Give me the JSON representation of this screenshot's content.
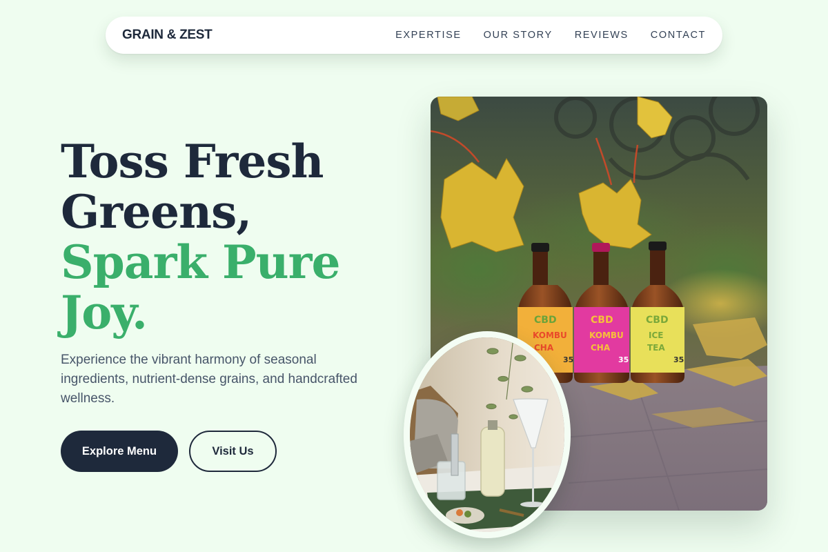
{
  "brand": {
    "name": "GRAIN & ZEST"
  },
  "nav": {
    "items": [
      {
        "label": "EXPERTISE"
      },
      {
        "label": "OUR STORY"
      },
      {
        "label": "REVIEWS"
      },
      {
        "label": "CONTACT"
      }
    ]
  },
  "hero": {
    "title_line1": "Toss Fresh",
    "title_line2": "Greens,",
    "title_line3": "Spark Pure",
    "title_line4": "Joy.",
    "description": "Experience the vibrant harmony of seasonal ingredients, nutrient-dense grains, and handcrafted wellness.",
    "primary_button": "Explore Menu",
    "secondary_button": "Visit Us"
  },
  "colors": {
    "background": "#effdf0",
    "dark": "#1e293b",
    "accent_green": "#3aaf6b",
    "muted_text": "#475569"
  },
  "images": {
    "main_photo": "bottled-drinks-photo",
    "secondary_photo": "table-setting-photo",
    "bottle_labels": [
      {
        "line1": "CBD",
        "line2": "KOMBU",
        "line3": "CHA"
      },
      {
        "line1": "CBD",
        "line2": "KOMBU",
        "line3": "CHA"
      },
      {
        "line1": "CBD",
        "line2": "ICE",
        "line3": "TEA"
      }
    ]
  }
}
